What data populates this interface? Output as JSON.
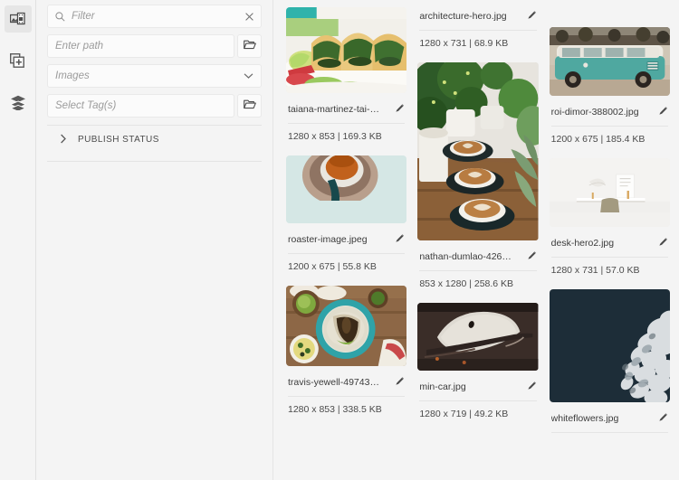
{
  "rail": {
    "items": [
      {
        "icon": "assets-media-icon",
        "name": "rail-item-assets",
        "active": true
      },
      {
        "icon": "copy-add-icon",
        "name": "rail-item-create",
        "active": false
      },
      {
        "icon": "layers-icon",
        "name": "rail-item-layers",
        "active": false
      }
    ]
  },
  "panel": {
    "filter": {
      "placeholder": "Filter",
      "value": "",
      "clear_label": "×"
    },
    "path": {
      "placeholder": "Enter path",
      "value": ""
    },
    "type": {
      "value": "Images",
      "options": [
        "Images"
      ]
    },
    "tags": {
      "placeholder": "Select Tag(s)",
      "value": ""
    },
    "publish_status": {
      "label": "PUBLISH STATUS",
      "expanded": false
    }
  },
  "colors": {
    "page_bg": "#f4f4f4",
    "field_bg": "#fbfbfb",
    "border": "#e4e4e4",
    "text": "#3b3b3b",
    "placeholder": "#9b9b9b"
  },
  "grid": {
    "columns": [
      {
        "cards": [
          {
            "name": "taiana-martinez-tai-s-...",
            "dims": "1280 x 853 | 169.3 KB",
            "thumb": "tacos-photo",
            "thumb_h": 95,
            "clipped_top": false
          },
          {
            "name": "roaster-image.jpeg",
            "dims": "1200 x 675 | 55.8 KB",
            "thumb": "coffee-roaster-photo",
            "thumb_h": 75,
            "clipped_top": false
          },
          {
            "name": "travis-yewell-497435-...",
            "dims": "1280 x 853 | 338.5 KB",
            "thumb": "tacos-plate-photo",
            "thumb_h": 89,
            "clipped_top": false
          }
        ]
      },
      {
        "cards": [
          {
            "name": "architecture-hero.jpg",
            "dims": "1280 x 731 | 68.9 KB",
            "thumb": "architecture-photo",
            "thumb_h": 0,
            "clipped_top": true
          },
          {
            "name": "nathan-dumlao-4266...",
            "dims": "853 x 1280 | 258.6 KB",
            "thumb": "latte-plants-photo",
            "thumb_h": 197,
            "clipped_top": false
          },
          {
            "name": "min-car.jpg",
            "dims": "1280 x 719 | 49.2 KB",
            "thumb": "dark-car-photo",
            "thumb_h": 75,
            "clipped_top": false
          }
        ]
      },
      {
        "cards": [
          {
            "name": "roi-dimor-388002.jpg",
            "dims": "1200 x 675 | 185.4 KB",
            "thumb": "vw-bus-photo",
            "thumb_h": 76,
            "clipped_top": false
          },
          {
            "name": "desk-hero2.jpg",
            "dims": "1280 x 731 | 57.0 KB",
            "thumb": "desk-photo",
            "thumb_h": 76,
            "clipped_top": false
          },
          {
            "name": "whiteflowers.jpg",
            "dims": "",
            "thumb": "white-flowers-photo",
            "thumb_h": 125,
            "clipped_top": false
          }
        ]
      }
    ]
  }
}
